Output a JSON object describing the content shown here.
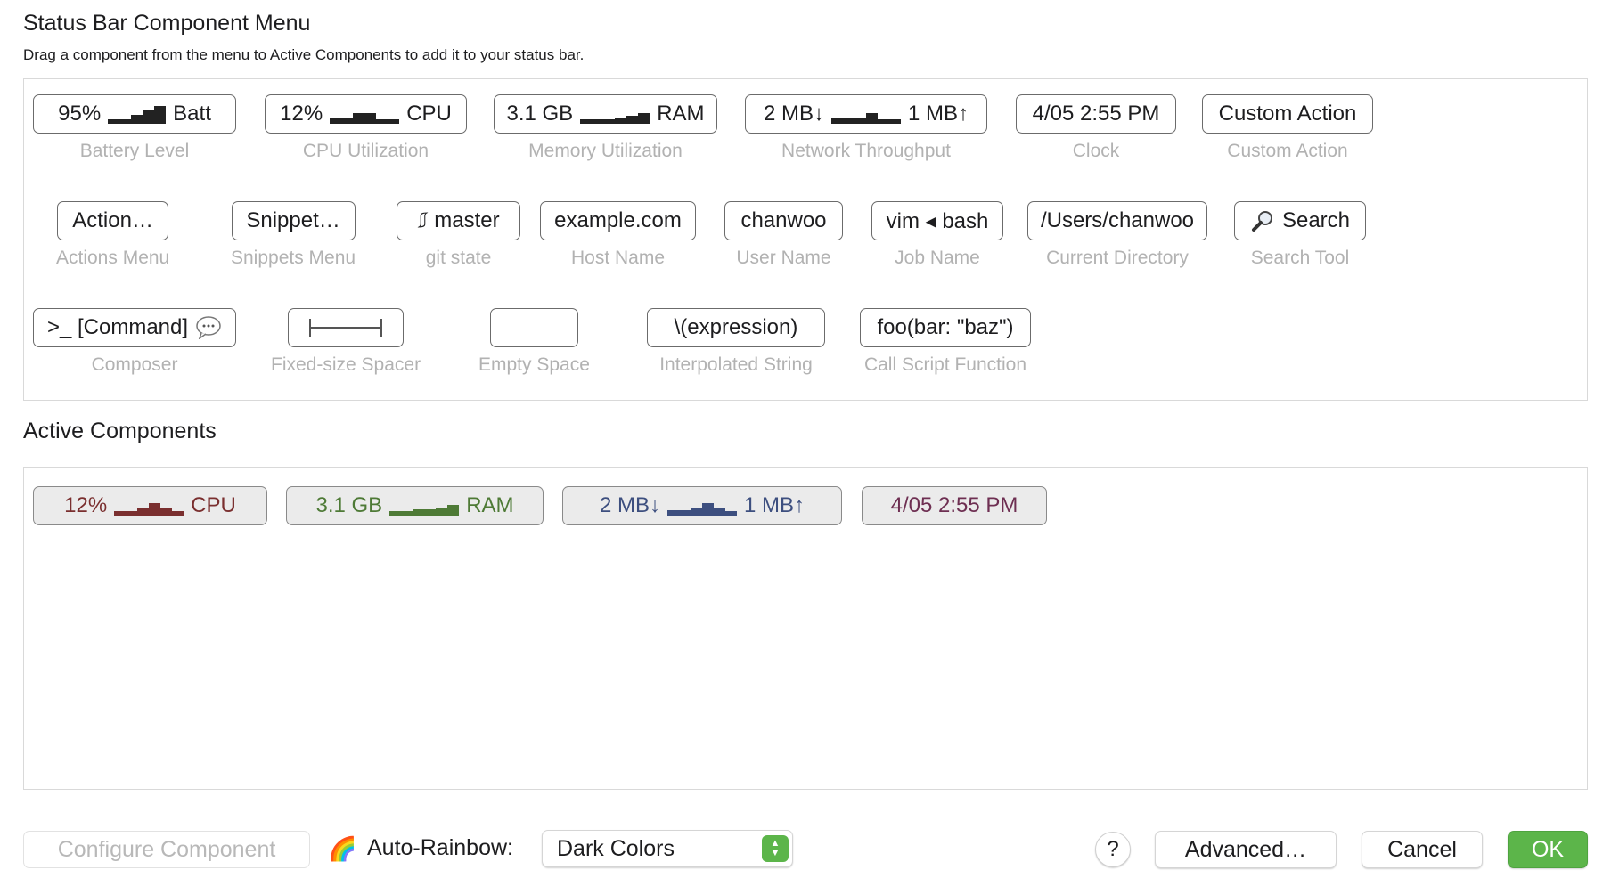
{
  "header": {
    "title": "Status Bar Component Menu",
    "subtitle": "Drag a component from the menu to Active Components to add it to your status bar."
  },
  "menu": {
    "battery": {
      "value": "95%",
      "unit": "Batt",
      "label": "Battery Level"
    },
    "cpu": {
      "value": "12%",
      "unit": "CPU",
      "label": "CPU Utilization"
    },
    "memory": {
      "value": "3.1 GB",
      "unit": "RAM",
      "label": "Memory Utilization"
    },
    "network": {
      "down": "2 MB↓",
      "up": "1 MB↑",
      "label": "Network Throughput"
    },
    "clock": {
      "value": "4/05 2:55 PM",
      "label": "Clock"
    },
    "custom_action": {
      "value": "Custom Action",
      "label": "Custom Action"
    },
    "actions_menu": {
      "value": "Action…",
      "label": "Actions Menu"
    },
    "snippets_menu": {
      "value": "Snippet…",
      "label": "Snippets Menu"
    },
    "git_state": {
      "value": "⎎ master",
      "label": "git state"
    },
    "host_name": {
      "value": "example.com",
      "label": "Host Name"
    },
    "user_name": {
      "value": "chanwoo",
      "label": "User Name"
    },
    "job_name": {
      "value": "vim ◂ bash",
      "label": "Job Name"
    },
    "current_directory": {
      "value": "/Users/chanwoo",
      "label": "Current Directory"
    },
    "search_tool": {
      "value": "Search",
      "label": "Search Tool",
      "icon": "magnifier-icon"
    },
    "composer": {
      "value": ">_ [Command]",
      "label": "Composer",
      "icon": "speech-bubble-icon"
    },
    "fixed_spacer": {
      "label": "Fixed-size Spacer",
      "icon": "spacer-icon"
    },
    "empty_space": {
      "label": "Empty Space"
    },
    "interpolated_string": {
      "value": "\\(expression)",
      "label": "Interpolated String"
    },
    "call_script": {
      "value": "foo(bar: \"baz\")",
      "label": "Call Script Function"
    }
  },
  "active": {
    "title": "Active Components",
    "cpu": {
      "value": "12%",
      "unit": "CPU",
      "color": "#7a2f2f"
    },
    "memory": {
      "value": "3.1 GB",
      "unit": "RAM",
      "color": "#4e7a36"
    },
    "network": {
      "down": "2 MB↓",
      "up": "1 MB↑",
      "color": "#3d4f7f"
    },
    "clock": {
      "value": "4/05 2:55 PM",
      "color": "#6e2f52"
    }
  },
  "footer": {
    "configure_label": "Configure Component",
    "auto_rainbow_label": "Auto-Rainbow:",
    "rainbow_icon": "🌈",
    "rainbow_select_value": "Dark Colors",
    "help_label": "?",
    "advanced_label": "Advanced…",
    "cancel_label": "Cancel",
    "ok_label": "OK",
    "ok_color": "#5cb54a"
  }
}
